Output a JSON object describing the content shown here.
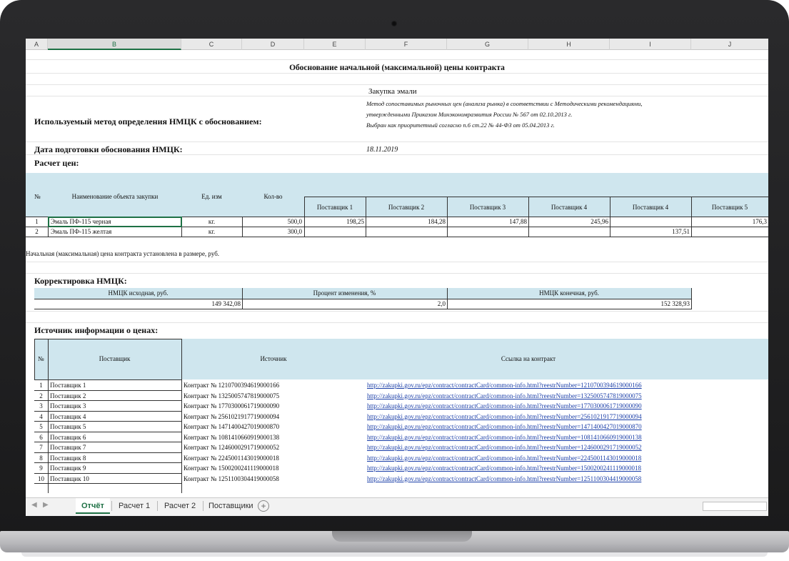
{
  "columns": [
    "A",
    "B",
    "C",
    "D",
    "E",
    "F",
    "G",
    "H",
    "I",
    "J"
  ],
  "title": "Обоснование начальной (максимальной) цены контракта",
  "purchase": "Закупка эмали",
  "method_label": "Используемый метод определения НМЦК с обоснованием:",
  "method_text": [
    "Метод сопоставимых рыночных цен (анализа рынка) в соответствии с Методическими рекомендациями,",
    "утвержденными Приказом Минэкономразвития России № 567 от 02.10.2013 г.",
    "Выбран как приоритетный согласно п.6 ст.22 № 44-ФЗ от 05.04.2013 г."
  ],
  "date_label": "Дата подготовки обоснования НМЦК:",
  "date_value": "18.11.2019",
  "calc_label": "Расчет цен:",
  "price_table": {
    "headers": {
      "num": "№",
      "name": "Наименование объекта закупки",
      "unit": "Ед. изм",
      "qty": "Кол-во"
    },
    "suppliers": [
      "Поставщик 1",
      "Поставщик 2",
      "Поставщик 3",
      "Поставщик 4",
      "Поставщик 4",
      "Поставщик 5"
    ],
    "rows": [
      {
        "num": "1",
        "name": "Эмаль ПФ-115 черная",
        "unit": "кг.",
        "qty": "500,0",
        "prices": [
          "198,25",
          "184,28",
          "147,88",
          "245,96",
          "",
          "176,3"
        ]
      },
      {
        "num": "2",
        "name": "Эмаль ПФ-115 желтая",
        "unit": "кг.",
        "qty": "300,0",
        "prices": [
          "",
          "",
          "",
          "",
          "137,51",
          ""
        ]
      }
    ]
  },
  "initial_price_text": "Начальная (максимальная) цена контракта установлена в размере, руб.",
  "correction_label": "Корректировка НМЦК:",
  "correction": {
    "h1": "НМЦК исходная, руб.",
    "h2": "Процент изменения, %",
    "h3": "НМЦК конечная, руб.",
    "v1": "149 342,08",
    "v2": "2,0",
    "v3": "152 328,93"
  },
  "sources_label": "Источник информации о ценах:",
  "sources_table": {
    "headers": {
      "num": "№",
      "supplier": "Поставщик",
      "source": "Источник",
      "link": "Ссылка на контракт"
    },
    "rows": [
      {
        "num": "1",
        "supplier": "Поставщик 1",
        "source": "Контракт № 1210700394619000166",
        "link": "http://zakupki.gov.ru/epz/contract/contractCard/common-info.html?reestrNumber=1210700394619000166"
      },
      {
        "num": "2",
        "supplier": "Поставщик 2",
        "source": "Контракт № 1325005747819000075",
        "link": "http://zakupki.gov.ru/epz/contract/contractCard/common-info.html?reestrNumber=1325005747819000075"
      },
      {
        "num": "3",
        "supplier": "Поставщик 3",
        "source": "Контракт № 1770300061719000090",
        "link": "http://zakupki.gov.ru/epz/contract/contractCard/common-info.html?reestrNumber=1770300061719000090"
      },
      {
        "num": "4",
        "supplier": "Поставщик 4",
        "source": "Контракт № 2561021917719000094",
        "link": "http://zakupki.gov.ru/epz/contract/contractCard/common-info.html?reestrNumber=2561021917719000094"
      },
      {
        "num": "5",
        "supplier": "Поставщик 5",
        "source": "Контракт № 1471400427019000870",
        "link": "http://zakupki.gov.ru/epz/contract/contractCard/common-info.html?reestrNumber=1471400427019000870"
      },
      {
        "num": "6",
        "supplier": "Поставщик 6",
        "source": "Контракт № 1081410660919000138",
        "link": "http://zakupki.gov.ru/epz/contract/contractCard/common-info.html?reestrNumber=1081410660919000138"
      },
      {
        "num": "7",
        "supplier": "Поставщик 7",
        "source": "Контракт № 1246000291719000052",
        "link": "http://zakupki.gov.ru/epz/contract/contractCard/common-info.html?reestrNumber=1246000291719000052"
      },
      {
        "num": "8",
        "supplier": "Поставщик 8",
        "source": "Контракт № 2245001143019000018",
        "link": "http://zakupki.gov.ru/epz/contract/contractCard/common-info.html?reestrNumber=2245001143019000018"
      },
      {
        "num": "9",
        "supplier": "Поставщик 9",
        "source": "Контракт № 1500200241119000018",
        "link": "http://zakupki.gov.ru/epz/contract/contractCard/common-info.html?reestrNumber=1500200241119000018"
      },
      {
        "num": "10",
        "supplier": "Поставщик 10",
        "source": "Контракт № 1251100304419000058",
        "link": "http://zakupki.gov.ru/epz/contract/contractCard/common-info.html?reestrNumber=1251100304419000058"
      }
    ]
  },
  "sheet_tabs": [
    "Отчёт",
    "Расчет 1",
    "Расчет 2",
    "Поставщики"
  ],
  "active_tab": "Отчёт",
  "colors": {
    "header_band": "#cfe6ee",
    "accent": "#1e7145",
    "link": "#1a3ea8"
  }
}
